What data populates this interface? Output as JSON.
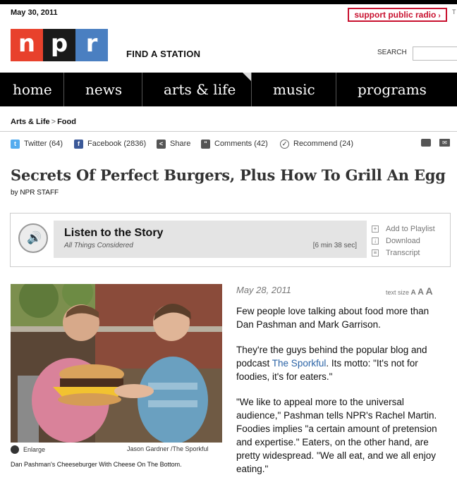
{
  "header": {
    "date": "May 30, 2011",
    "support_label": "support public radio",
    "support_arrow": "›",
    "corner_glyph": "T",
    "logo_letters": [
      "n",
      "p",
      "r"
    ],
    "find_station": "FIND A STATION",
    "search_label": "SEARCH",
    "search_value": "",
    "colors": {
      "brand_red": "#e8412c",
      "brand_black": "#1a1a1a",
      "brand_blue": "#4a7fc1",
      "support_red": "#c8102e"
    }
  },
  "nav": {
    "items": [
      "home",
      "news",
      "arts & life",
      "music",
      "programs"
    ],
    "programs_caret": "▾"
  },
  "breadcrumb": {
    "section": "Arts & Life",
    "separator": ">",
    "subsection": "Food"
  },
  "share": {
    "twitter": "Twitter (64)",
    "facebook": "Facebook (2836)",
    "share": "Share",
    "comments": "Comments (42)",
    "recommend": "Recommend (24)",
    "icons": [
      "twitter-icon",
      "facebook-icon",
      "share-icon",
      "comments-icon",
      "recommend-icon",
      "print-icon",
      "email-icon"
    ]
  },
  "article": {
    "headline": "Secrets Of Perfect Burgers, Plus How To Grill An Egg",
    "byline": "by NPR STAFF",
    "date": "May 28, 2011",
    "text_size_label": "text size",
    "text_size_options": [
      "A",
      "A",
      "A"
    ],
    "paragraphs": [
      "Few people love talking about food more than Dan Pashman and Mark Garrison.",
      "\"We like to appeal more to the universal audience,\" Pashman tells NPR's Rachel Martin. Foodies implies \"a certain amount of pretension and expertise.\" Eaters, on the other hand, are pretty widespread. \"We all eat, and we all enjoy eating.\""
    ],
    "p2_before": "They're the guys behind the popular blog and podcast ",
    "p2_link": "The Sporkful",
    "p2_after": ". Its motto: \"It's not for foodies, it's for eaters.\""
  },
  "player": {
    "title": "Listen to the Story",
    "show": "All Things Considered",
    "duration": "[6 min 38 sec]",
    "actions": [
      "Add to Playlist",
      "Download",
      "Transcript"
    ]
  },
  "photo": {
    "enlarge": "Enlarge",
    "credit": "Jason Gardner /The Sporkful",
    "caption": "Dan Pashman's Cheeseburger With Cheese On The Bottom."
  }
}
